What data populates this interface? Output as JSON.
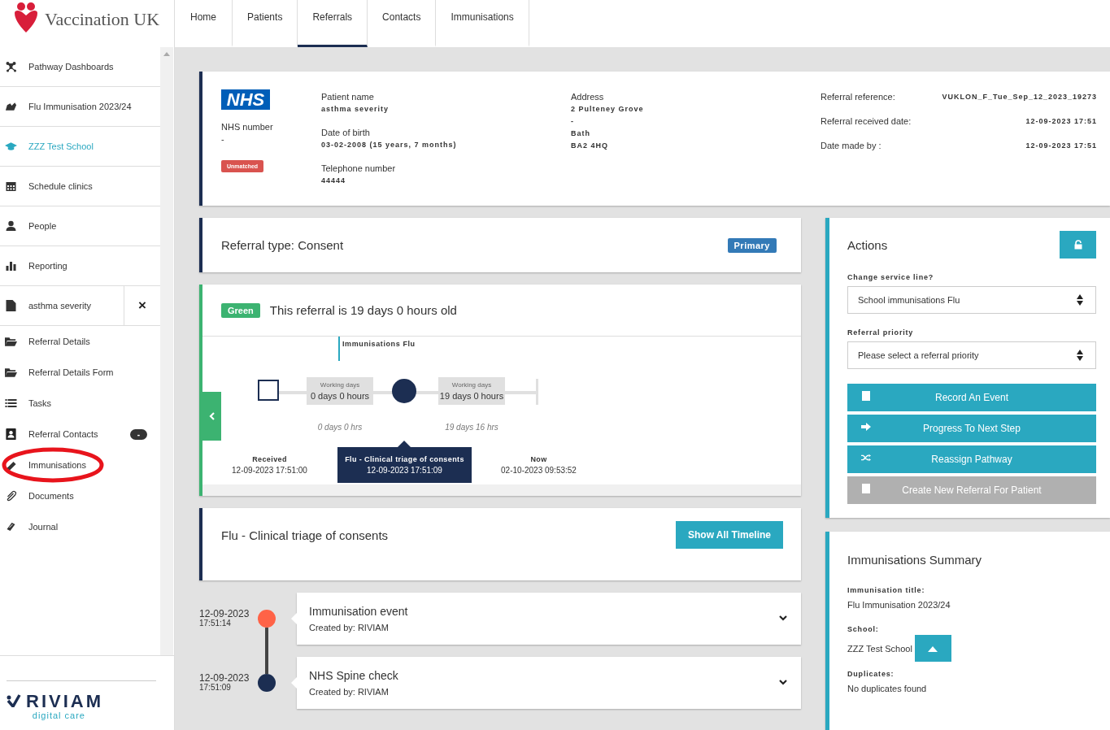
{
  "brand": {
    "name": "Vaccination UK"
  },
  "nav_tabs": [
    {
      "label": "Home",
      "selected": false
    },
    {
      "label": "Patients",
      "selected": false
    },
    {
      "label": "Referrals",
      "selected": true
    },
    {
      "label": "Contacts",
      "selected": false
    },
    {
      "label": "Immunisations",
      "selected": false
    }
  ],
  "sidebar": {
    "items": [
      {
        "label": "Pathway Dashboards",
        "selected": false
      },
      {
        "label": "Flu Immunisation 2023/24",
        "selected": false
      },
      {
        "label": "ZZZ Test School",
        "selected": true
      },
      {
        "label": "Schedule clinics",
        "selected": false
      },
      {
        "label": "People",
        "selected": false
      },
      {
        "label": "Reporting",
        "selected": false
      }
    ],
    "open_record": {
      "label": "asthma severity",
      "close": "×"
    },
    "record_items": [
      {
        "label": "Referral Details",
        "circled": false
      },
      {
        "label": "Referral Details Form",
        "circled": false
      },
      {
        "label": "Tasks",
        "circled": false
      },
      {
        "label": "Referral Contacts",
        "badge": "-",
        "circled": false
      },
      {
        "label": "Immunisations",
        "circled": true
      },
      {
        "label": "Documents",
        "circled": false
      },
      {
        "label": "Journal",
        "circled": false
      }
    ],
    "footer_logo": {
      "name": "RIVIAM",
      "tagline": "digital care"
    }
  },
  "patient": {
    "logo": "NHS",
    "nhs_number_label": "NHS number",
    "nhs_number": "-",
    "match_status": "Unmatched",
    "fields": [
      {
        "label": "Patient name",
        "value": "asthma severity"
      },
      {
        "label": "Date of birth",
        "value": "03-02-2008 (15 years, 7 months)"
      },
      {
        "label": "Telephone number",
        "value": "44444"
      }
    ],
    "address_label": "Address",
    "address_lines": [
      "2 Pulteney Grove",
      "-",
      "Bath",
      "BA2 4HQ"
    ],
    "referral_fields": [
      {
        "label": "Referral reference:",
        "value": "VUKLON_F_Tue_Sep_12_2023_19273"
      },
      {
        "label": "Referral received date:",
        "value": "12-09-2023 17:51"
      },
      {
        "label": "Date made by :",
        "value": "12-09-2023 17:51"
      }
    ]
  },
  "referral_type": {
    "text": "Referral type: Consent",
    "badge": "Primary"
  },
  "status": {
    "rag": "Green",
    "color": "#3cb371",
    "text": "This referral is 19 days 0 hours old",
    "pathway_label": "Immunisations Flu",
    "segments": [
      {
        "caption": "Working days",
        "duration": "0 days 0 hrs",
        "value": "0 days 0 hours"
      },
      {
        "caption": "Working days",
        "duration": "19 days 16 hrs",
        "value": "19 days 0 hours"
      }
    ],
    "milestones": [
      {
        "title": "Received",
        "time": "12-09-2023 17:51:00",
        "selected": false
      },
      {
        "title": "Flu - Clinical triage of consents",
        "time": "12-09-2023 17:51:09",
        "selected": true
      },
      {
        "title": "Now",
        "time": "02-10-2023 09:53:52",
        "selected": false
      }
    ]
  },
  "current_step": {
    "title": "Flu - Clinical triage of consents",
    "button": "Show All Timeline"
  },
  "events": [
    {
      "date": "12-09-2023",
      "time": "17:51:14",
      "title": "Immunisation event",
      "created_by": "Created by: RIVIAM",
      "color": "#ff6347"
    },
    {
      "date": "12-09-2023",
      "time": "17:51:09",
      "title": "NHS Spine check",
      "created_by": "Created by: RIVIAM",
      "color": "#1c2e52"
    }
  ],
  "actions": {
    "title": "Actions",
    "service_line_label": "Change service line?",
    "service_line": "School immunisations Flu",
    "priority_label": "Referral priority",
    "priority_placeholder": "Please select a referral priority",
    "buttons": [
      {
        "label": "Record An Event",
        "disabled": false
      },
      {
        "label": "Progress To Next Step",
        "disabled": false
      },
      {
        "label": "Reassign Pathway",
        "disabled": false
      },
      {
        "label": "Create New Referral For Patient",
        "disabled": true
      }
    ]
  },
  "summary": {
    "title": "Immunisations Summary",
    "fields": [
      {
        "label": "Immunisation title:",
        "value": "Flu Immunisation 2023/24"
      },
      {
        "label": "School:",
        "value": "ZZZ Test School",
        "kind": "school"
      },
      {
        "label": "Duplicates:",
        "value": "No duplicates found"
      }
    ]
  }
}
